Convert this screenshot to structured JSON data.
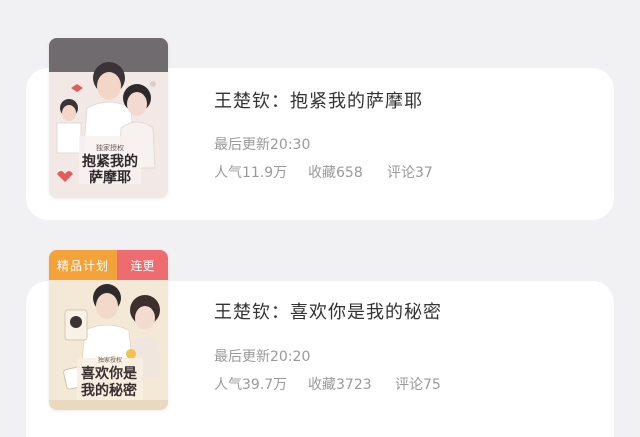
{
  "books": [
    {
      "title": "王楚钦：抱紧我的萨摩耶",
      "updated": "最后更新20:30",
      "popularity": "人气11.9万",
      "favorites": "收藏658",
      "comments": "评论37",
      "cover_text": "抱紧我的萨摩耶",
      "cover_tag": "独家授权"
    },
    {
      "title": "王楚钦：喜欢你是我的秘密",
      "updated": "最后更新20:20",
      "popularity": "人气39.7万",
      "favorites": "收藏3723",
      "comments": "评论75",
      "badge_left": "精品计划",
      "badge_right": "连更",
      "cover_text_line1": "喜欢你是",
      "cover_text_line2": "我的秘密",
      "cover_tag": "独家授权"
    }
  ],
  "colors": {
    "background": "#f1f1f3",
    "card": "#ffffff",
    "badge_orange": "#f6a23a",
    "badge_red": "#ee6b6f",
    "title_text": "#333333",
    "meta_text": "#9a9a9a"
  }
}
